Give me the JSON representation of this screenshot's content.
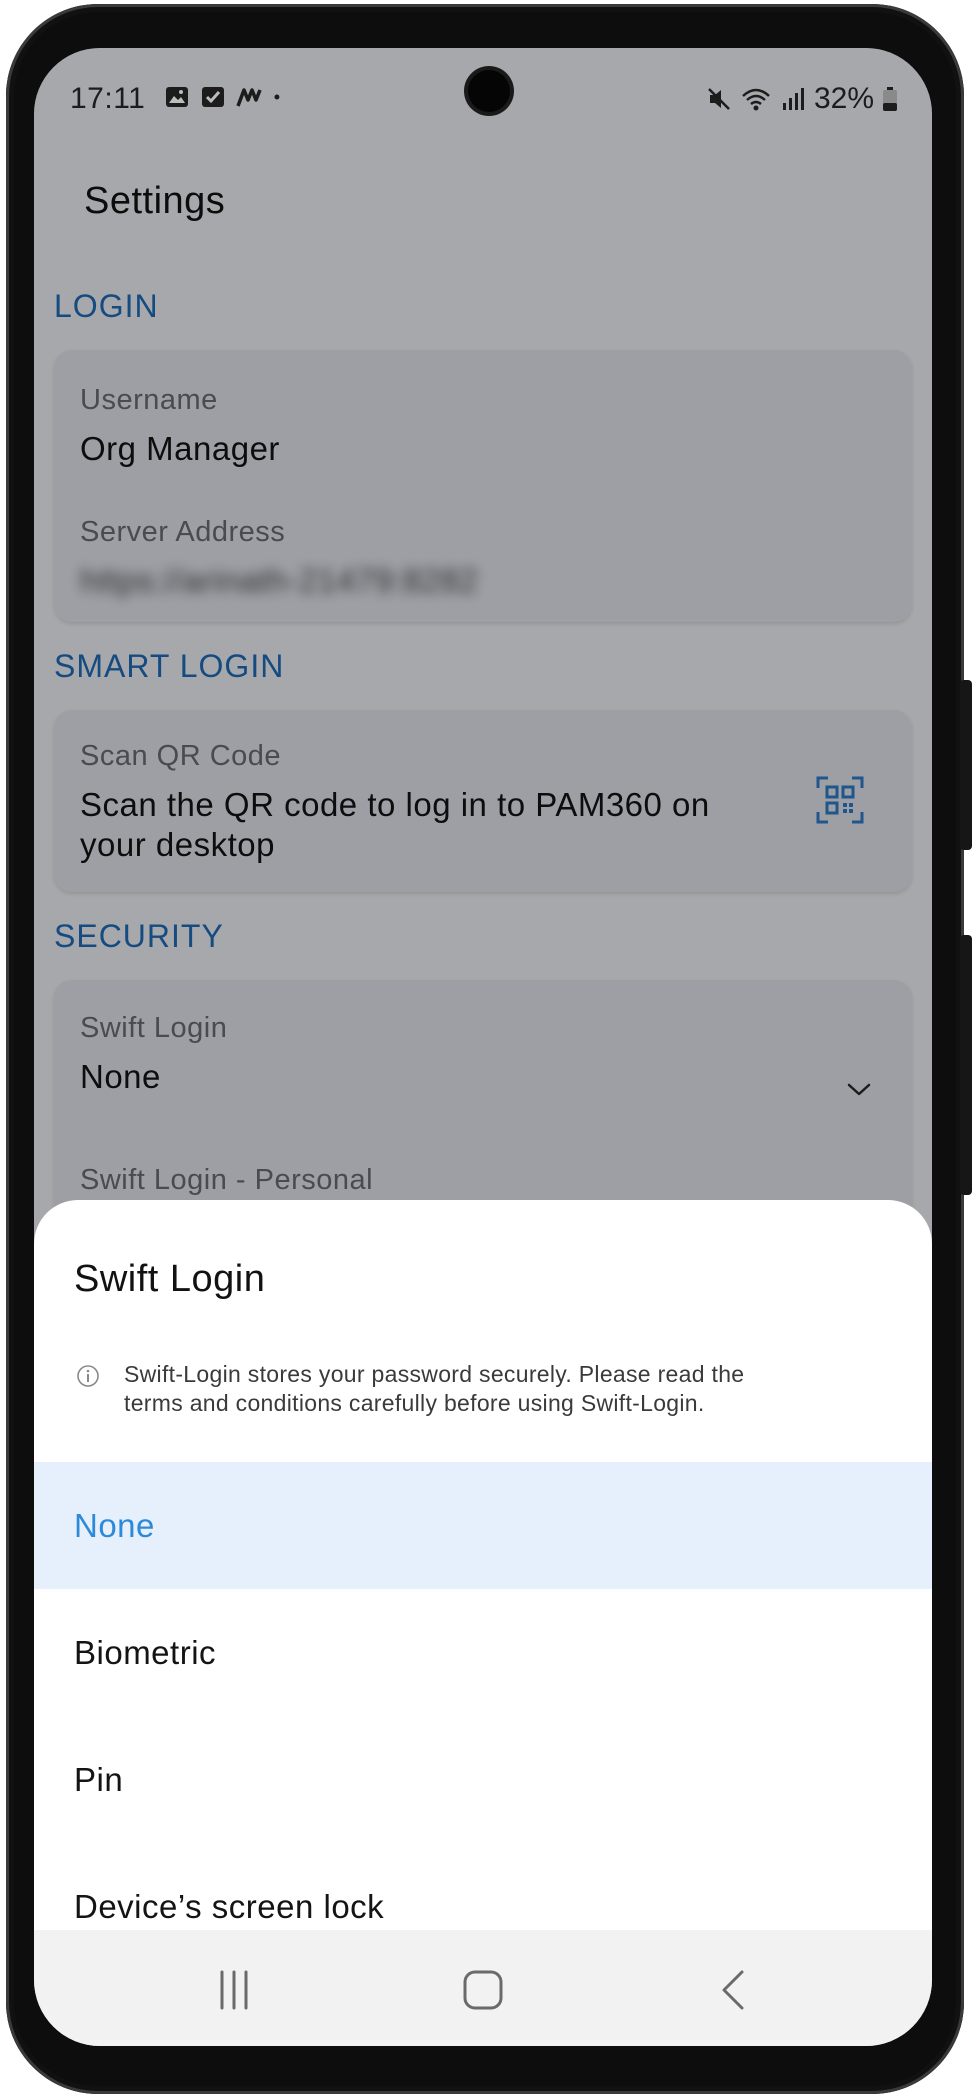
{
  "status_bar": {
    "time": "17:11",
    "battery": "32%",
    "left_icons": [
      "image-icon",
      "checkbox-icon",
      "app-logo-icon",
      "dot-icon"
    ],
    "right_icons": [
      "mute-icon",
      "wifi-icon",
      "signal-icon",
      "battery-icon"
    ]
  },
  "settings": {
    "title": "Settings",
    "sections": {
      "login": {
        "header": "LOGIN",
        "username_label": "Username",
        "username_value": "Org Manager",
        "server_label": "Server Address",
        "server_value": "https://arinath-21479:8282"
      },
      "smart_login": {
        "header": "SMART LOGIN",
        "scan_label": "Scan QR Code",
        "scan_desc_line1": "Scan the QR code to log in to PAM360 on",
        "scan_desc_line2": "your desktop"
      },
      "security": {
        "header": "SECURITY",
        "swift_label": "Swift Login",
        "swift_value": "None",
        "swift_personal_label": "Swift Login - Personal"
      }
    }
  },
  "sheet": {
    "title": "Swift Login",
    "info_line1": "Swift-Login stores your password securely. Please read the",
    "info_line2": "terms and conditions carefully before using Swift-Login.",
    "options": [
      "None",
      "Biometric",
      "Pin",
      "Device’s screen lock"
    ],
    "selected_index": 0
  },
  "colors": {
    "accent": "#2e8ad8",
    "section_header": "#1f6fbf",
    "selected_bg": "#e5f0fc",
    "card_bg": "#e9ebf4"
  }
}
